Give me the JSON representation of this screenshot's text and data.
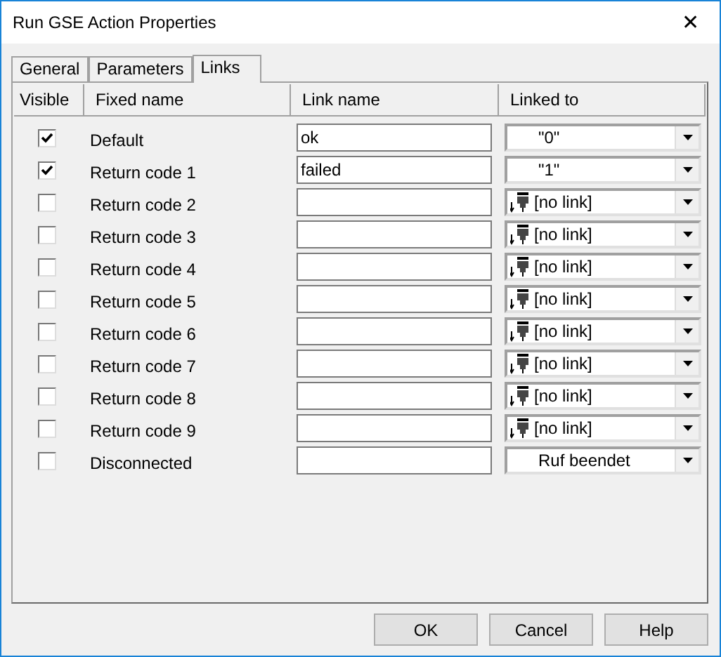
{
  "window": {
    "title": "Run GSE Action Properties",
    "close": "✕"
  },
  "tabs": [
    {
      "label": "General",
      "selected": false
    },
    {
      "label": "Parameters",
      "selected": false
    },
    {
      "label": "Links",
      "selected": true
    }
  ],
  "table": {
    "columns": [
      "Visible",
      "Fixed name",
      "Link name",
      "Linked to"
    ],
    "rows": [
      {
        "visible": true,
        "fixed_name": "Default",
        "link_name": "ok",
        "linked_to": {
          "kind": "value",
          "text": "\"0\""
        }
      },
      {
        "visible": true,
        "fixed_name": "Return code 1",
        "link_name": "failed",
        "linked_to": {
          "kind": "value",
          "text": "\"1\""
        }
      },
      {
        "visible": false,
        "fixed_name": "Return code 2",
        "link_name": "",
        "linked_to": {
          "kind": "link",
          "text": "[no link]"
        }
      },
      {
        "visible": false,
        "fixed_name": "Return code 3",
        "link_name": "",
        "linked_to": {
          "kind": "link",
          "text": "[no link]"
        }
      },
      {
        "visible": false,
        "fixed_name": "Return code 4",
        "link_name": "",
        "linked_to": {
          "kind": "link",
          "text": "[no link]"
        }
      },
      {
        "visible": false,
        "fixed_name": "Return code 5",
        "link_name": "",
        "linked_to": {
          "kind": "link",
          "text": "[no link]"
        }
      },
      {
        "visible": false,
        "fixed_name": "Return code 6",
        "link_name": "",
        "linked_to": {
          "kind": "link",
          "text": "[no link]"
        }
      },
      {
        "visible": false,
        "fixed_name": "Return code 7",
        "link_name": "",
        "linked_to": {
          "kind": "link",
          "text": "[no link]"
        }
      },
      {
        "visible": false,
        "fixed_name": "Return code 8",
        "link_name": "",
        "linked_to": {
          "kind": "link",
          "text": "[no link]"
        }
      },
      {
        "visible": false,
        "fixed_name": "Return code 9",
        "link_name": "",
        "linked_to": {
          "kind": "link",
          "text": "[no link]"
        }
      },
      {
        "visible": false,
        "fixed_name": "Disconnected",
        "link_name": "",
        "linked_to": {
          "kind": "value",
          "text": "Ruf beendet"
        }
      }
    ]
  },
  "buttons": [
    "OK",
    "Cancel",
    "Help"
  ]
}
